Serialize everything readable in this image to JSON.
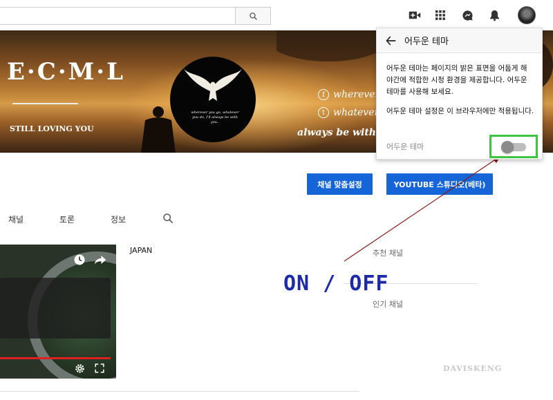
{
  "search": {
    "placeholder": "",
    "value": ""
  },
  "banner": {
    "brand": "E·C·M·L",
    "tagline": "STILL LOVING YOU",
    "motto": "wherever you go, whatever you do, I'll always be with you..",
    "social_1": "wherever",
    "social_1_icon": "f",
    "social_2": "whatever",
    "social_2_icon": "t",
    "always": "always be with yo"
  },
  "buttons": {
    "customize": "채널 맞춤설정",
    "studio": "YOUTUBE 스튜디오(베타)"
  },
  "tabs": [
    {
      "label": "채널"
    },
    {
      "label": "토론"
    },
    {
      "label": "정보"
    }
  ],
  "video": {
    "title": "JAPAN"
  },
  "sidebar": {
    "recommended": "추천 채널",
    "popular": "인기 채널"
  },
  "panel": {
    "title": "어두운 테마",
    "description": "어두운 테마는 페이지의 밝은 표면을 어둡게 해 야간에 적합한 시청 환경을 제공합니다. 어두운 테마를 사용해 보세요.",
    "note": "어두운 테마 설정은 이 브라우저에만 적용됩니다.",
    "toggle_label": "어두운 테마",
    "toggle_on": false
  },
  "annotation": {
    "text": "ON / OFF",
    "color": "#1d2aa8",
    "highlight": "#3ec53e",
    "arrow": "#8b1a1a"
  },
  "watermark": "DAVISKENG",
  "colors": {
    "accent": "#1565d8"
  }
}
